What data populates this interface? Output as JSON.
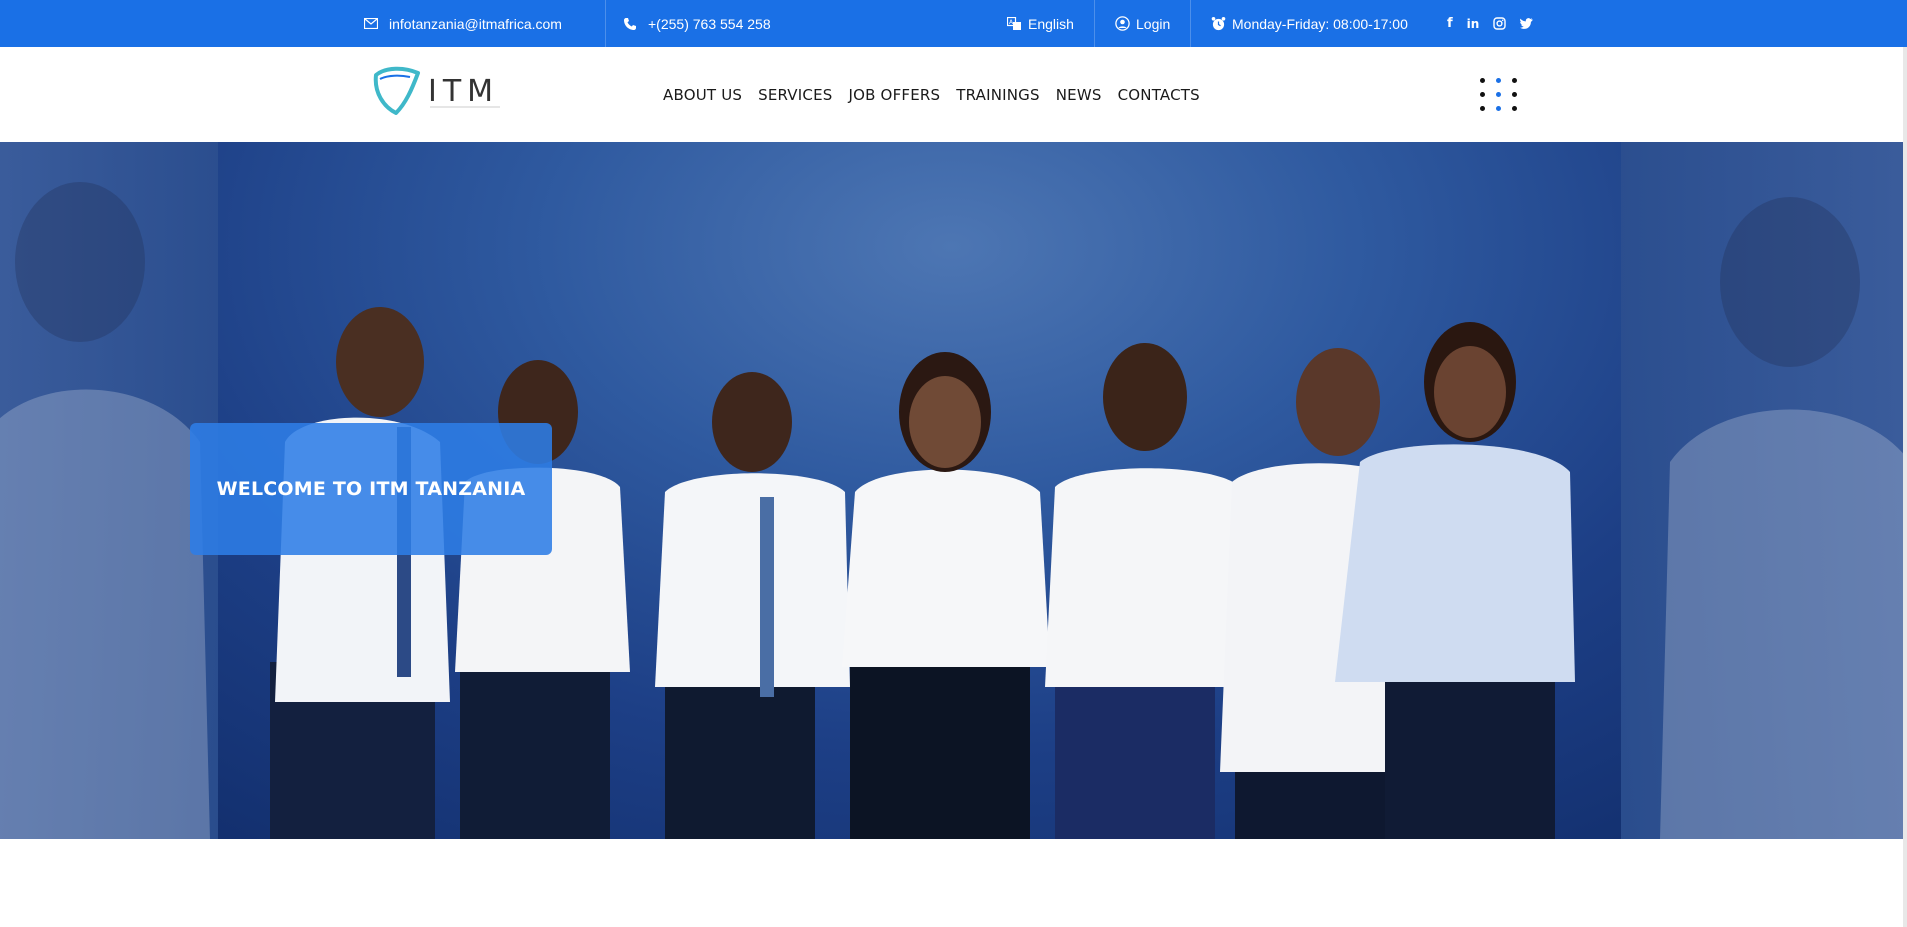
{
  "topbar": {
    "email": "infotanzania@itmafrica.com",
    "phone": "+(255) 763 554 258",
    "language": "English",
    "login": "Login",
    "hours": "Monday-Friday: 08:00-17:00",
    "social_icons": [
      "facebook-icon",
      "linkedin-icon",
      "instagram-icon",
      "twitter-icon"
    ]
  },
  "header": {
    "logo_text": "ITM",
    "nav": [
      "ABOUT US",
      "SERVICES",
      "JOB OFFERS",
      "TRAININGS",
      "NEWS",
      "CONTACTS"
    ]
  },
  "hero": {
    "welcome": "WELCOME TO ITM TANZANIA"
  },
  "colors": {
    "brand_blue": "#1a70e6",
    "logo_teal": "#3fb8c9",
    "hero_blue": "#1d3f86"
  }
}
